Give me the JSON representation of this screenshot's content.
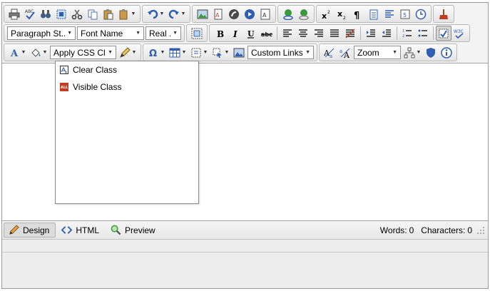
{
  "toolbar": {
    "paragraph_style": "Paragraph St...",
    "font_name": "Font Name",
    "font_size": "Real ...",
    "css_class": "Apply CSS Cl...",
    "custom_links": "Custom Links",
    "zoom": "Zoom"
  },
  "css_popup": {
    "items": [
      {
        "label": "Clear Class"
      },
      {
        "label": "Visible Class"
      }
    ]
  },
  "modes": {
    "design": "Design",
    "html": "HTML",
    "preview": "Preview"
  },
  "counts": {
    "words_label": "Words:",
    "words_value": "0",
    "chars_label": "Characters:",
    "chars_value": "0"
  },
  "colors": {
    "accent_blue": "#2f5fb3",
    "icon_red": "#c23b22",
    "icon_green": "#3a9a3a",
    "toolbar_bg": "#ececec"
  }
}
